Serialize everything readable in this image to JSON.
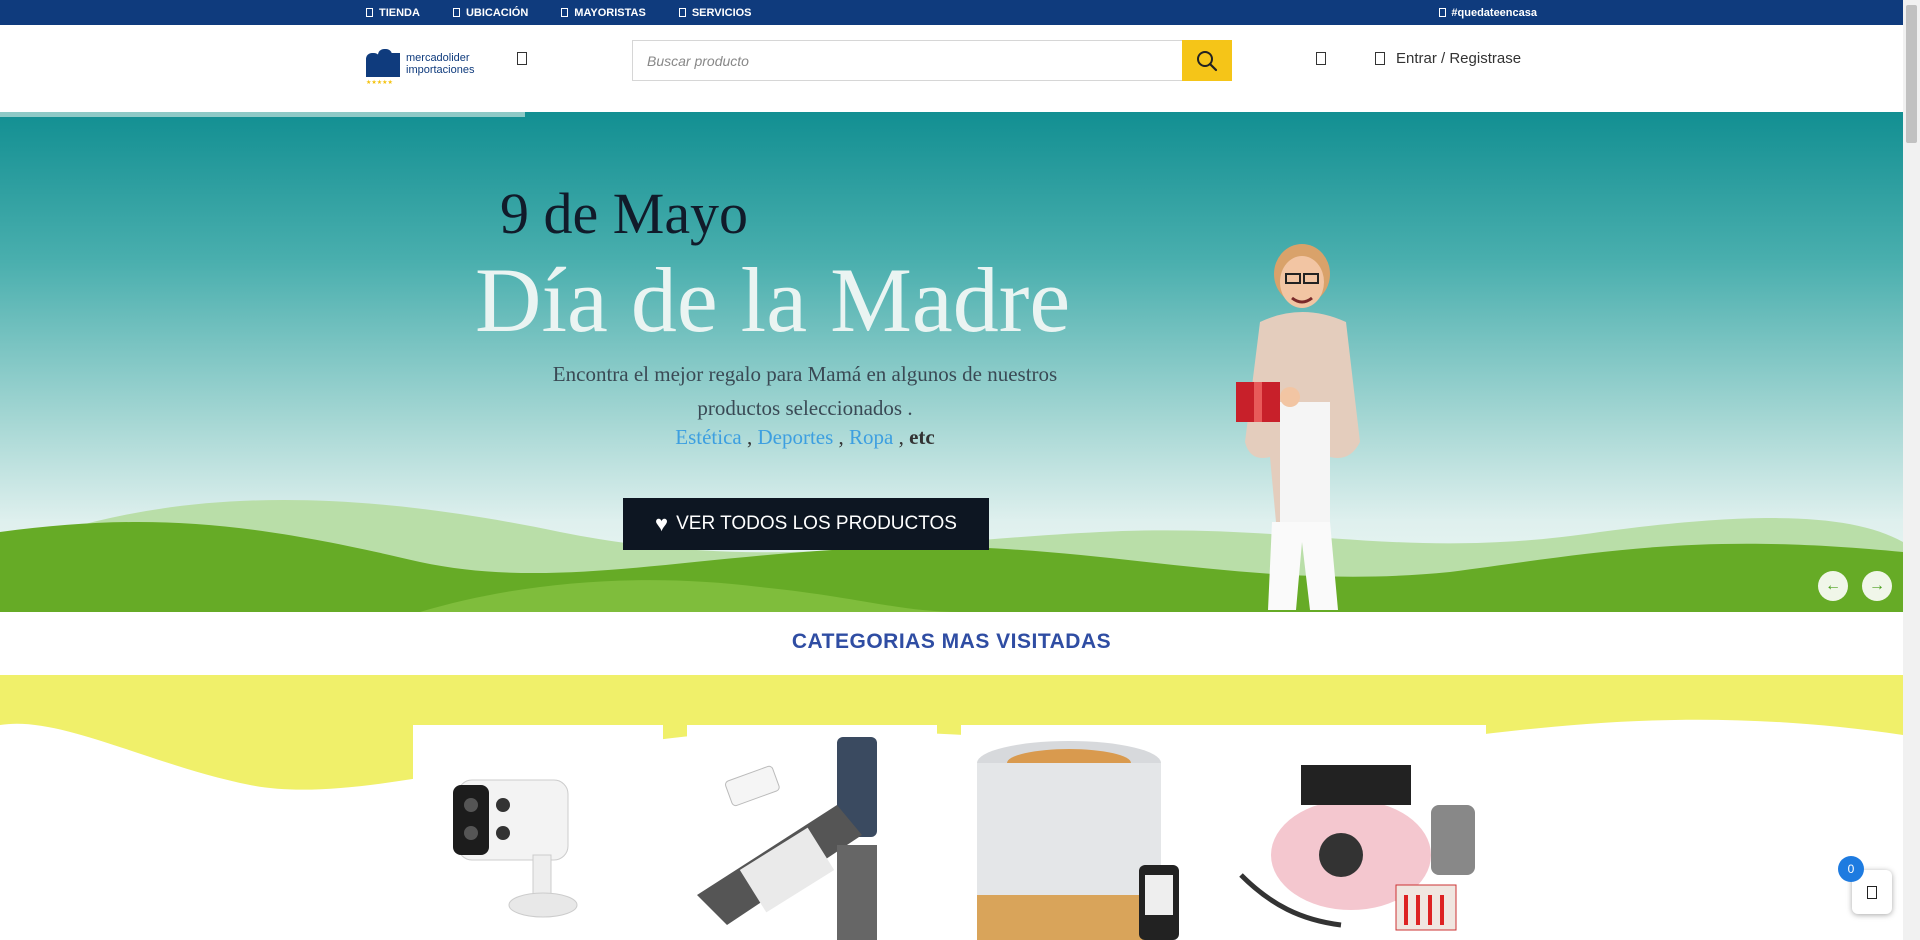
{
  "topbar": {
    "nav": [
      "TIENDA",
      "UBICACIÓN",
      "MAYORISTAS",
      "SERVICIOS"
    ],
    "hashtag": "#quedateencasa"
  },
  "header": {
    "logo_line1": "mercadolider",
    "logo_line2": "importaciones",
    "search_placeholder": "Buscar producto",
    "login_label": "Entrar / Registrase"
  },
  "hero": {
    "date": "9 de Mayo",
    "headline": "Día de la Madre",
    "description": "Encontra el mejor regalo para Mamá en algunos de nuestros productos seleccionados .",
    "categories": [
      "Estética",
      "Deportes",
      "Ropa"
    ],
    "etc": "etc",
    "cta_label": "VER TODOS LOS PRODUCTOS",
    "prev_arrow": "←",
    "next_arrow": "→"
  },
  "categories": {
    "title": "CATEGORIAS MAS VISITADAS",
    "cards": [
      {
        "name": "security-camera"
      },
      {
        "name": "solar-street-light"
      },
      {
        "name": "aroma-diffuser"
      },
      {
        "name": "nail-drill"
      }
    ]
  },
  "cart": {
    "count": "0"
  },
  "colors": {
    "topbar": "#0f3b7d",
    "search_button": "#f5c518",
    "cta": "#0d1622",
    "category_title": "#2f4da3",
    "link": "#3d9fe0",
    "badge": "#1e7be0"
  }
}
